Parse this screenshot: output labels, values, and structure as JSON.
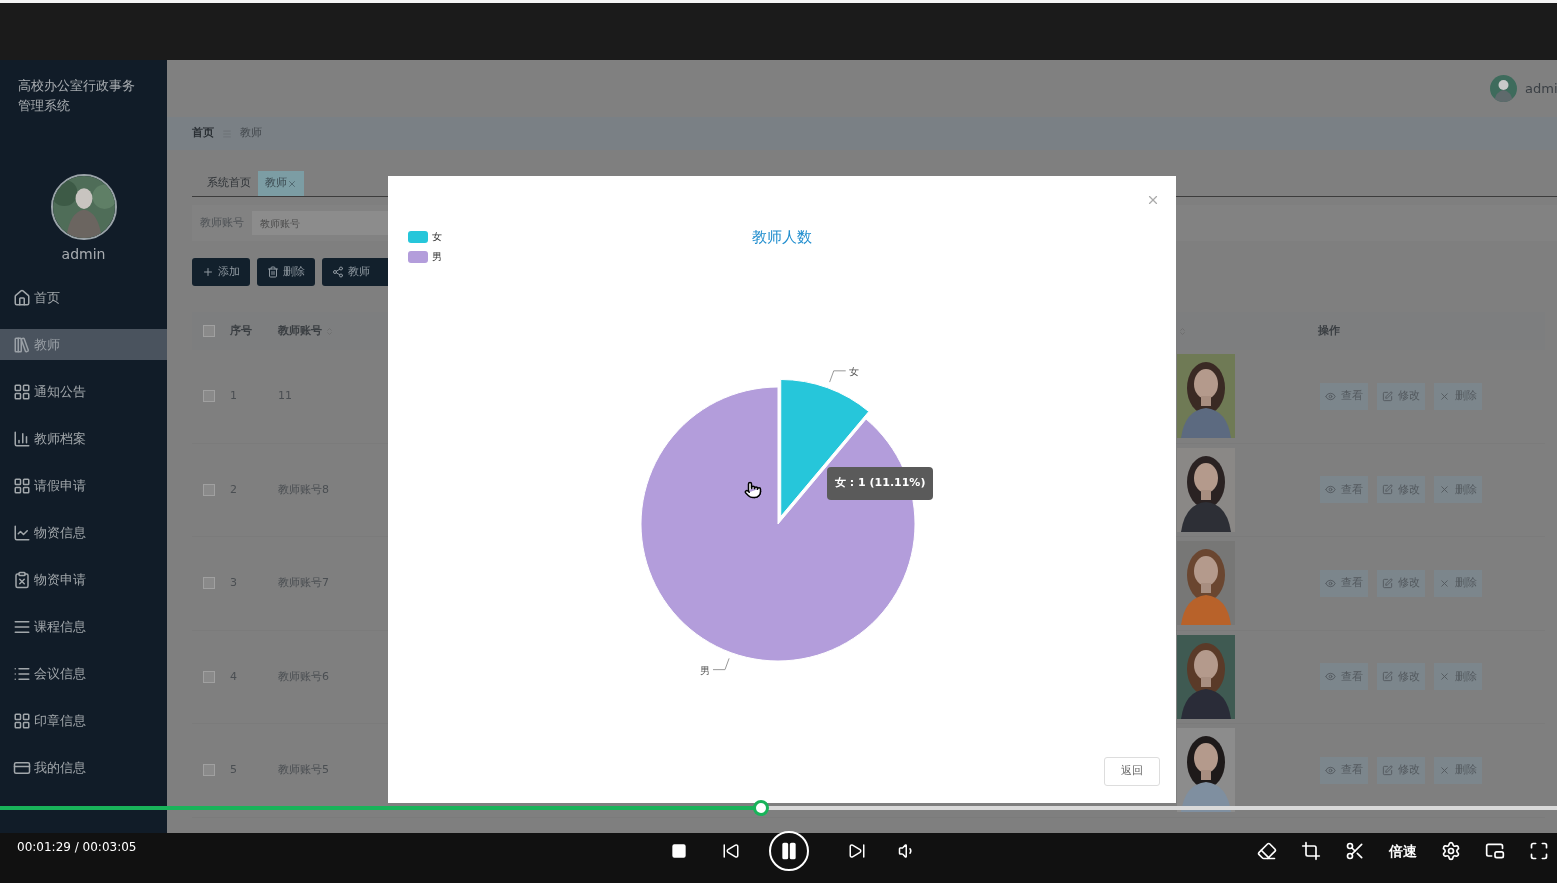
{
  "sidebar": {
    "title": "高校办公室行政事务管理系统",
    "user": "admin",
    "items": [
      {
        "label": "首页",
        "selected": false
      },
      {
        "label": "教师",
        "selected": true
      },
      {
        "label": "通知公告",
        "selected": false
      },
      {
        "label": "教师档案",
        "selected": false
      },
      {
        "label": "请假申请",
        "selected": false
      },
      {
        "label": "物资信息",
        "selected": false
      },
      {
        "label": "物资申请",
        "selected": false
      },
      {
        "label": "课程信息",
        "selected": false
      },
      {
        "label": "会议信息",
        "selected": false
      },
      {
        "label": "印章信息",
        "selected": false
      },
      {
        "label": "我的信息",
        "selected": false
      }
    ]
  },
  "header": {
    "user": "admi"
  },
  "breadcrumb": [
    "首页",
    "教师"
  ],
  "tabs": [
    {
      "label": "系统首页",
      "selected": false
    },
    {
      "label": "教师",
      "selected": true
    }
  ],
  "search": {
    "label": "教师账号",
    "placeholder": "教师账号"
  },
  "buttons": [
    {
      "label": "添加",
      "kind": "add"
    },
    {
      "label": "删除",
      "kind": "delete"
    },
    {
      "label": "教师",
      "kind": "chart"
    }
  ],
  "table": {
    "header": {
      "checked": false,
      "index": "序号",
      "account": "教师账号",
      "actions": "操作"
    },
    "rows": [
      {
        "index": "1",
        "account": "11",
        "checked": false,
        "actions": [
          "查看",
          "修改",
          "删除"
        ]
      },
      {
        "index": "2",
        "account": "教师账号8",
        "checked": false,
        "actions": [
          "查看",
          "修改",
          "删除"
        ]
      },
      {
        "index": "3",
        "account": "教师账号7",
        "checked": false,
        "actions": [
          "查看",
          "修改",
          "删除"
        ]
      },
      {
        "index": "4",
        "account": "教师账号6",
        "checked": false,
        "actions": [
          "查看",
          "修改",
          "删除"
        ]
      },
      {
        "index": "5",
        "account": "教师账号5",
        "checked": false,
        "actions": [
          "查看",
          "修改",
          "删除"
        ]
      }
    ]
  },
  "modal": {
    "legend": [
      {
        "label": "女",
        "color": "#26c6da"
      },
      {
        "label": "男",
        "color": "#b39ddb"
      }
    ],
    "chart_data": {
      "type": "pie",
      "title": "教师人数",
      "categories": [
        "女",
        "男"
      ],
      "values": [
        11.11,
        88.89
      ]
    },
    "tooltip": "女 : 1 (11.11%)",
    "button": "返回"
  },
  "player": {
    "time": "00:01:29 / 00:03:05",
    "level": 0.489,
    "playing": true,
    "speed_label": "倍速"
  }
}
